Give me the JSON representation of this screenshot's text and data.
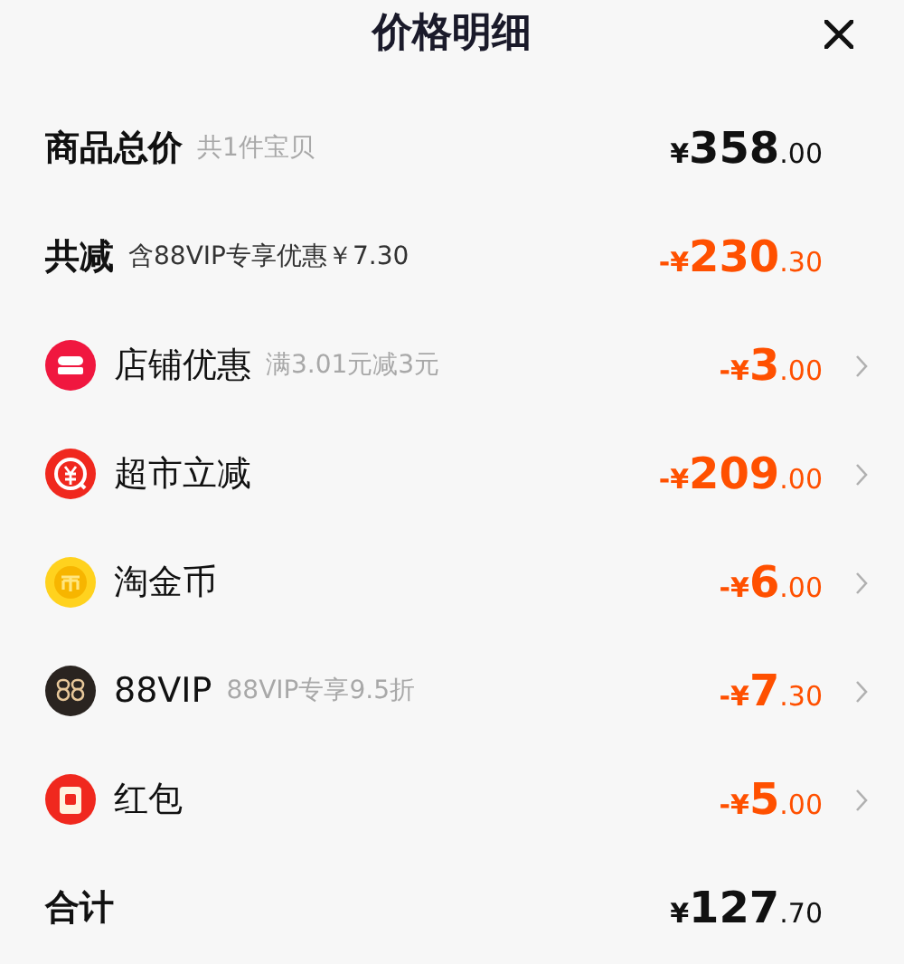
{
  "title": "价格明细",
  "rows": [
    {
      "kind": "summary",
      "label": "商品总价",
      "note": "共1件宝贝",
      "note_dark": false,
      "amount": {
        "prefix": "¥",
        "main": "358",
        "cents": ".00"
      },
      "negative": false
    },
    {
      "kind": "summary",
      "label": "共减",
      "note": "含88VIP专享优惠￥7.30",
      "note_dark": true,
      "amount": {
        "prefix": "-¥",
        "main": "230",
        "cents": ".30"
      },
      "negative": true
    },
    {
      "kind": "discount",
      "label": "店铺优惠",
      "note": "满3.01元减3元",
      "note_dark": false,
      "amount": {
        "prefix": "-¥",
        "main": "3",
        "cents": ".00"
      },
      "negative": true
    },
    {
      "kind": "discount",
      "label": "超市立减",
      "amount": {
        "prefix": "-¥",
        "main": "209",
        "cents": ".00"
      },
      "negative": true
    },
    {
      "kind": "discount",
      "label": "淘金币",
      "amount": {
        "prefix": "-¥",
        "main": "6",
        "cents": ".00"
      },
      "negative": true
    },
    {
      "kind": "discount",
      "label": "88VIP",
      "note": "88VIP专享9.5折",
      "note_dark": false,
      "amount": {
        "prefix": "-¥",
        "main": "7",
        "cents": ".30"
      },
      "negative": true
    },
    {
      "kind": "discount",
      "label": "红包",
      "amount": {
        "prefix": "-¥",
        "main": "5",
        "cents": ".00"
      },
      "negative": true
    },
    {
      "kind": "summary",
      "label": "合计",
      "amount": {
        "prefix": "¥",
        "main": "127",
        "cents": ".70"
      },
      "negative": false
    }
  ]
}
